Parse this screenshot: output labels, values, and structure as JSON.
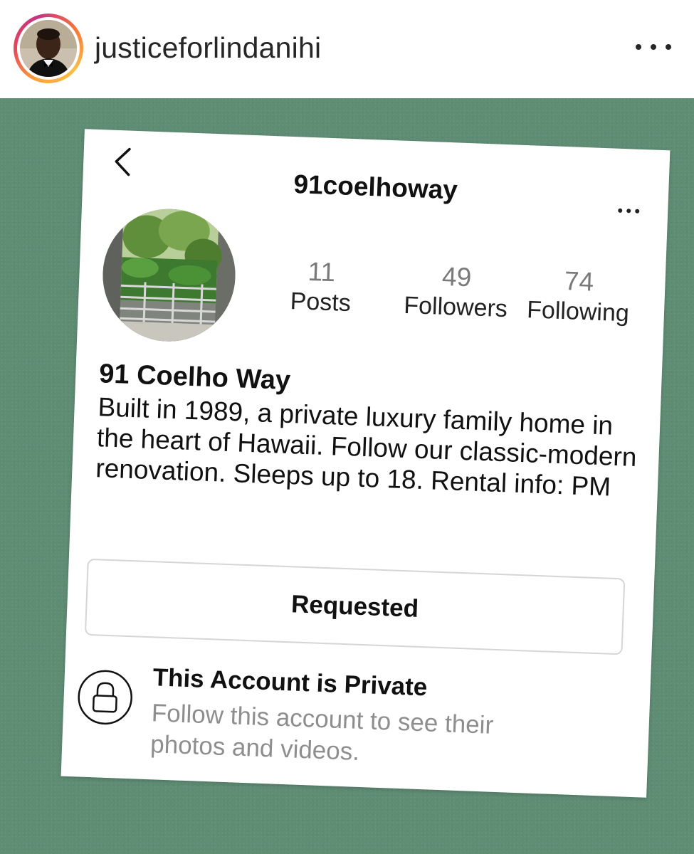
{
  "post": {
    "username": "justiceforlindanihi",
    "avatar_icon": "user-avatar-photo",
    "more_icon": "more-horizontal-icon"
  },
  "screenshot": {
    "header": {
      "username": "91coelhoway",
      "back_icon": "chevron-left-icon",
      "more_icon": "more-horizontal-icon"
    },
    "stats": {
      "posts": {
        "count": "11",
        "label": "Posts"
      },
      "followers": {
        "count": "49",
        "label": "Followers"
      },
      "following": {
        "count": "74",
        "label": "Following"
      }
    },
    "profile": {
      "display_name": "91 Coelho Way",
      "bio": "Built in 1989, a private luxury family home in the heart of Hawaii. Follow our classic-modern renovation. Sleeps up to 18. Rental info: PM"
    },
    "follow_button": {
      "label": "Requested"
    },
    "private_notice": {
      "icon": "lock-icon",
      "title": "This Account is Private",
      "subtitle": "Follow this account to see their photos and videos."
    }
  },
  "colors": {
    "background_green": "#5f8d74",
    "text_dark": "#262626",
    "text_muted": "#8e8e8e",
    "button_border": "#d6d6d6"
  }
}
